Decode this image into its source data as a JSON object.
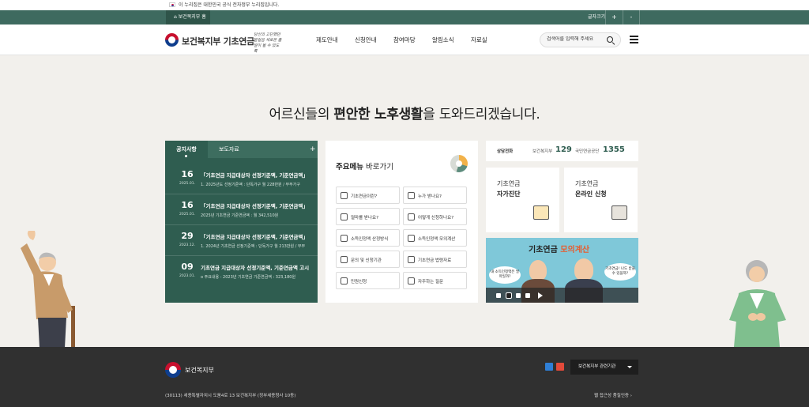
{
  "gov_banner": {
    "text": "이 누리집은 대한민국 공식 전자정부 누리집입니다."
  },
  "utility": {
    "home_label": "보건복지부 홈",
    "font_size_label": "글자크기",
    "increase_label": "+",
    "decrease_label": "-"
  },
  "header": {
    "logo_text": "보건복지부 기초연금",
    "slogan": "당신의 고단했던 발걸음 새로운 출발이 될 수 있도록",
    "nav": [
      "제도안내",
      "신청안내",
      "참여마당",
      "알림소식",
      "자료실"
    ],
    "search_placeholder": "검색어를 입력해 주세요"
  },
  "headline": {
    "pre": "어르신들의 ",
    "bold": "편안한 노후생활",
    "post": "을 도와드리겠습니다."
  },
  "notice": {
    "tab_active": "공지사항",
    "tab_other": "보도자료",
    "more": "+",
    "items": [
      {
        "day": "16",
        "ym": "2025.01.",
        "title": "「기초연금 지급대상자 선정기준액, 기준연금액」",
        "sub": "1. 2025년도 선정기준액 : 단독가구 월 228만원 / 부부가구"
      },
      {
        "day": "16",
        "ym": "2025.01.",
        "title": "「기초연금 지급대상자 선정기준액, 기준연금액」",
        "sub": "2025년 기초연금 기준연금액 : 월 342,510원"
      },
      {
        "day": "29",
        "ym": "2023.12.",
        "title": "「기초연금 지급대상자 선정기준액, 기준연금액」",
        "sub": "1. 2024년 기초연금 선정기준액 : 단독가구 월 213만원 / 부부"
      },
      {
        "day": "09",
        "ym": "2023.01.",
        "title": "기초연금 지급대상자 선정기준액, 기준연금액 고시",
        "sub": "o 주요내용 - 2023년 기초연금 기준연금액 : 323,180원"
      }
    ]
  },
  "menu": {
    "title_bold": "주요메뉴",
    "title_rest": " 바로가기",
    "buttons": [
      "기초연금이란?",
      "누가 받나요?",
      "얼마를 받나요?",
      "어떻게 신청하나요?",
      "소득인정액 산정방식",
      "소득인정액 모의계산",
      "문의 및 신청기관",
      "기초연금 법령자료",
      "민원신청",
      "자주하는 질문"
    ],
    "icons": [
      "coins-icon",
      "people-icon",
      "calculator-icon",
      "search-document-icon",
      "piggy-bank-icon",
      "money-bag-icon",
      "building-icon",
      "gavel-icon",
      "stamp-icon",
      "chat-bubbles-icon"
    ]
  },
  "call": {
    "label": "상담전화",
    "org1": "보건복지부",
    "num1": "129",
    "org2": "국민연금공단",
    "num2": "1355"
  },
  "cards": [
    {
      "l1": "기초연금",
      "l2": "자가진단"
    },
    {
      "l1": "기초연금",
      "l2": "온라인 신청"
    }
  ],
  "banner": {
    "title_pre": "기초연금 ",
    "title_accent": "모의계산",
    "bubble_left": "내 소득인정액은 얼마일까?",
    "bubble_right": "기초연금! 나도 받을 수 있을까?"
  },
  "footer": {
    "org": "보건복지부",
    "related": "보건복지부 관련기관",
    "address": "(30113) 세종특별자치시 도움4로 13 보건복지부 (정부세종청사 10동)",
    "accessibility": "웹 접근성 품질인증"
  },
  "colors": {
    "primary_green": "#2f5d50",
    "utility_green": "#3e6a5f",
    "footer_bg": "#303030",
    "accent_orange": "#e85b2d"
  }
}
